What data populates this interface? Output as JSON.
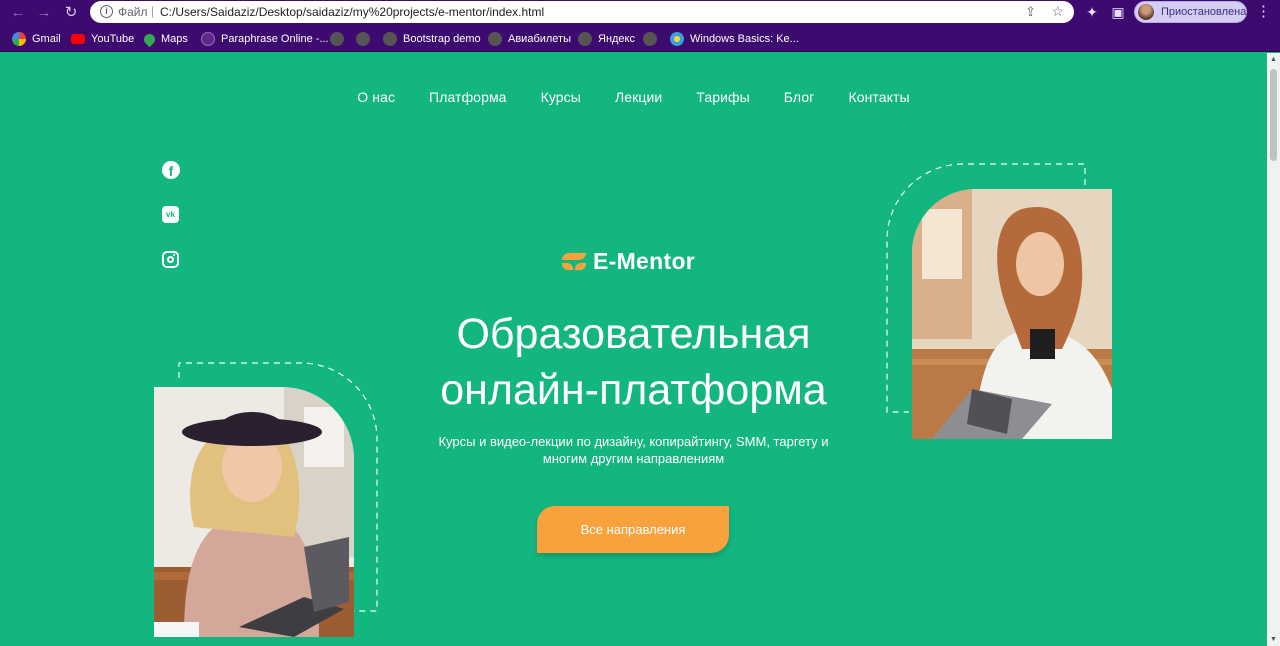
{
  "browser": {
    "omnibox": {
      "file_label": "Файл",
      "separator": "|",
      "url": "C:/Users/Saidaziz/Desktop/saidaziz/my%20projects/e-mentor/index.html"
    },
    "profile": {
      "label": "Приостановлена"
    },
    "bookmarks": [
      {
        "label": "Gmail",
        "icon": "google-icon",
        "color": "#ffffff"
      },
      {
        "label": "YouTube",
        "icon": "youtube-icon",
        "color": "#ff0000"
      },
      {
        "label": "Maps",
        "icon": "maps-icon",
        "color": "#34a853"
      },
      {
        "label": "Paraphrase Online -...",
        "icon": "paraphrase-icon",
        "color": "#5b2a86"
      },
      {
        "label": "",
        "icon": "globe-icon",
        "color": "#555555"
      },
      {
        "label": "",
        "icon": "globe-icon",
        "color": "#555555"
      },
      {
        "label": "Bootstrap demo",
        "icon": "globe-icon",
        "color": "#555555"
      },
      {
        "label": "Авиабилеты",
        "icon": "globe-icon",
        "color": "#555555"
      },
      {
        "label": "Яндекс",
        "icon": "globe-icon",
        "color": "#555555"
      },
      {
        "label": "",
        "icon": "globe-icon",
        "color": "#555555"
      },
      {
        "label": "Windows Basics: Ke...",
        "icon": "windows-basics-icon",
        "color": "#3aa0d8"
      }
    ]
  },
  "site": {
    "nav": [
      "О нас",
      "Платформа",
      "Курсы",
      "Лекции",
      "Тарифы",
      "Блог",
      "Контакты"
    ],
    "social": [
      {
        "icon": "facebook-icon",
        "glyph": "f"
      },
      {
        "icon": "vk-icon",
        "glyph": "vk"
      },
      {
        "icon": "instagram-icon",
        "glyph": ""
      }
    ],
    "logo": {
      "text": "E-Mentor"
    },
    "hero": {
      "title_line1": "Образовательная",
      "title_line2": "онлайн-платформа",
      "subtitle_line1": "Курсы и видео-лекции по дизайну, копирайтингу, SMM, таргету и",
      "subtitle_line2": "многим другим направлениям",
      "cta": "Все направления"
    }
  },
  "colors": {
    "background": "#14b680",
    "accent": "#f8a23e",
    "browser_chrome": "#3d0a6f"
  }
}
